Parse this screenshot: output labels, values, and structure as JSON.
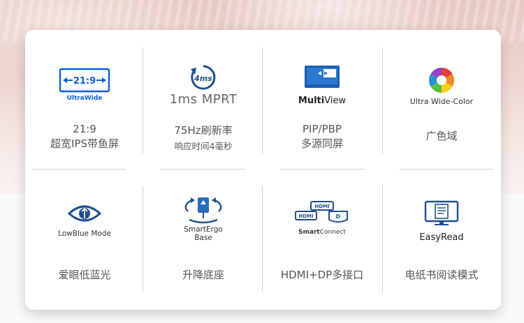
{
  "colors": {
    "brand_blue": "#0b5ed7",
    "text": "#555555",
    "divider": "#d2d2d2"
  },
  "features": [
    {
      "icon": "ultrawide-21-9-icon",
      "icon_text": "21:9",
      "caption": "UltraWide",
      "line1": "21:9",
      "line2": "超宽IPS带鱼屏"
    },
    {
      "icon": "response-time-icon",
      "icon_text": "4ms",
      "caption": "1ms MPRT",
      "line1": "75Hz刷新率",
      "line2": "响应时间4毫秒"
    },
    {
      "icon": "multiview-icon",
      "caption_bold": "Multi",
      "caption_rest": "View",
      "line1": "PIP/PBP",
      "line2": "多源同屏"
    },
    {
      "icon": "color-wheel-icon",
      "caption": "Ultra Wide-Color",
      "line1": "广色域"
    },
    {
      "icon": "eye-icon",
      "caption": "LowBlue Mode",
      "line1": "爱眼低蓝光"
    },
    {
      "icon": "ergo-base-icon",
      "caption_1": "SmartErgo",
      "caption_2": "Base",
      "line1": "升降底座"
    },
    {
      "icon": "smartconnect-icon",
      "caption_bold": "Smart",
      "caption_rest": "Connect",
      "hdmi": "HDMI",
      "line1": "HDMI+DP多接口"
    },
    {
      "icon": "easyread-icon",
      "caption": "EasyRead",
      "line1": "电纸书阅读模式"
    }
  ]
}
